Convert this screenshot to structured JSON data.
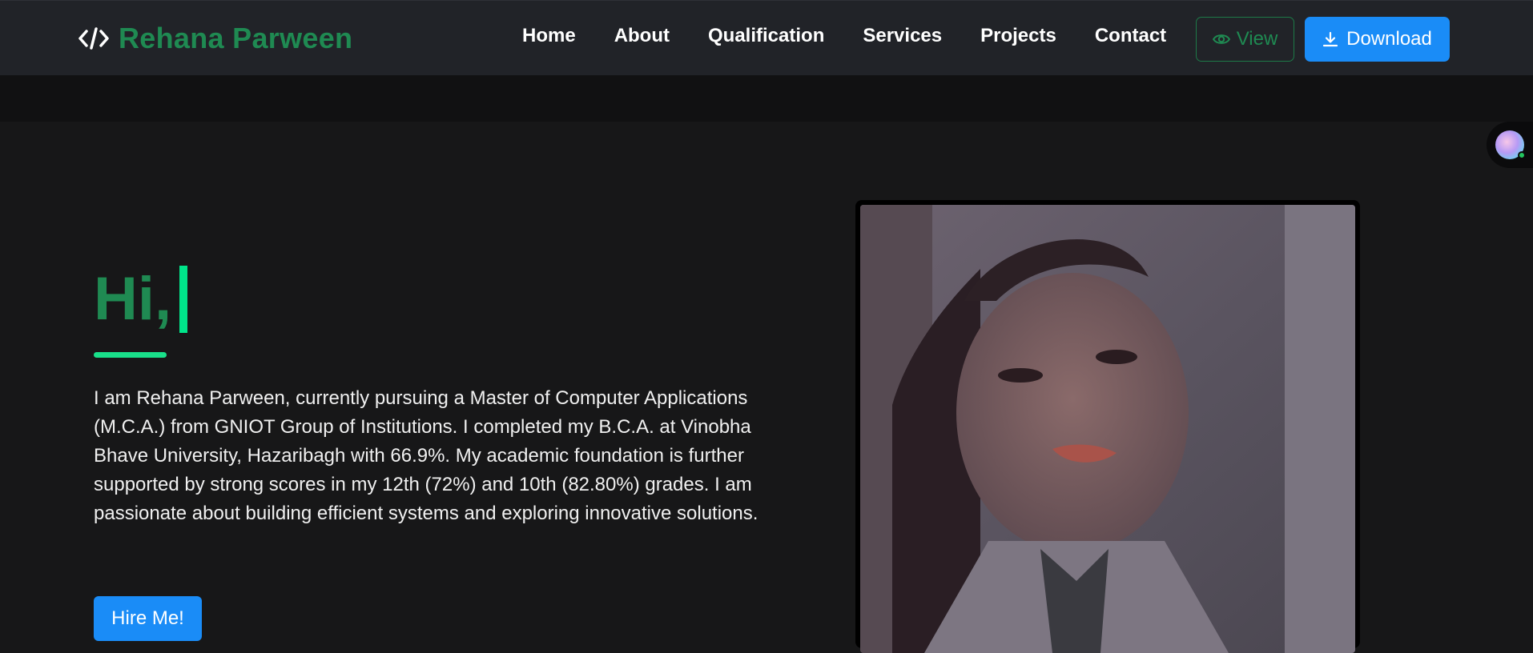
{
  "navbar": {
    "brand": {
      "icon": "code-icon",
      "name": "Rehana Parween"
    },
    "links": [
      {
        "label": "Home"
      },
      {
        "label": "About"
      },
      {
        "label": "Qualification"
      },
      {
        "label": "Services"
      },
      {
        "label": "Projects"
      },
      {
        "label": "Contact"
      }
    ],
    "view_button": {
      "icon": "eye-icon",
      "label": "View"
    },
    "download_button": {
      "icon": "download-icon",
      "label": "Download"
    }
  },
  "hero": {
    "greeting": "Hi,",
    "intro": "I am Rehana Parween, currently pursuing a Master of Computer Applications (M.C.A.) from GNIOT Group of Institutions. I completed my B.C.A. at Vinobha Bhave University, Hazaribagh with 66.9%. My academic foundation is further supported by strong scores in my 12th (72%) and 10th (82.80%) grades. I am passionate about building efficient systems and exploring innovative solutions.",
    "hire_button": "Hire Me!",
    "photo": {
      "icon": "profile-photo"
    }
  },
  "colors": {
    "brand_green": "#1f8a52",
    "accent_green": "#19e08a",
    "primary_blue": "#1a8cf7",
    "navbar_bg": "#212328",
    "page_bg": "#171718"
  }
}
